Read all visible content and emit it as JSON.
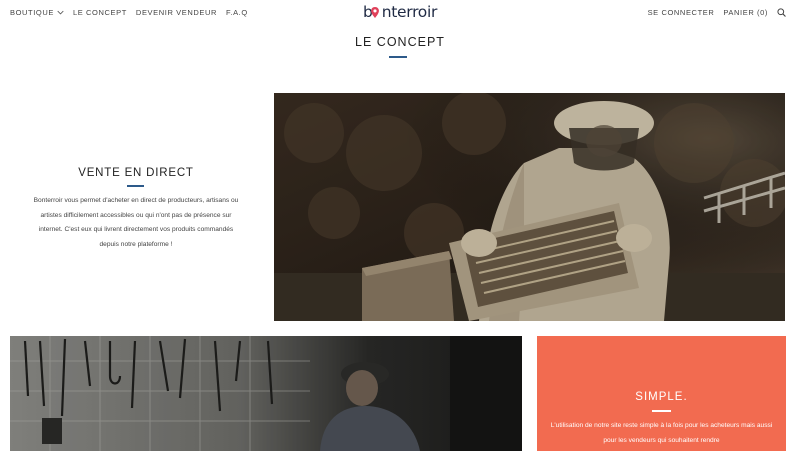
{
  "nav": {
    "left": [
      {
        "label": "BOUTIQUE",
        "has_dropdown": true
      },
      {
        "label": "LE CONCEPT"
      },
      {
        "label": "DEVENIR VENDEUR"
      },
      {
        "label": "F.A.Q"
      }
    ],
    "login_label": "SE CONNECTER",
    "cart_label": "PANIER (0)",
    "search_icon": "search-icon"
  },
  "logo": {
    "text": "bonterroir",
    "accent_color": "#e0405a"
  },
  "page": {
    "title": "LE CONCEPT"
  },
  "section_direct": {
    "heading": "VENTE EN DIRECT",
    "body": "Bonterroir vous permet d'acheter en direct de producteurs, artisans ou artistes difficilement accessibles ou qui n'ont pas de présence sur internet. C'est eux qui livrent directement vos produits commandés depuis notre plateforme !"
  },
  "section_simple": {
    "heading": "SIMPLE.",
    "body": "L'utilisation de notre site reste simple à la fois pour les acheteurs mais aussi pour les vendeurs qui souhaitent rendre",
    "background_color": "#f26b50"
  },
  "colors": {
    "accent_rule": "#2d5a8a",
    "text": "#222222"
  }
}
